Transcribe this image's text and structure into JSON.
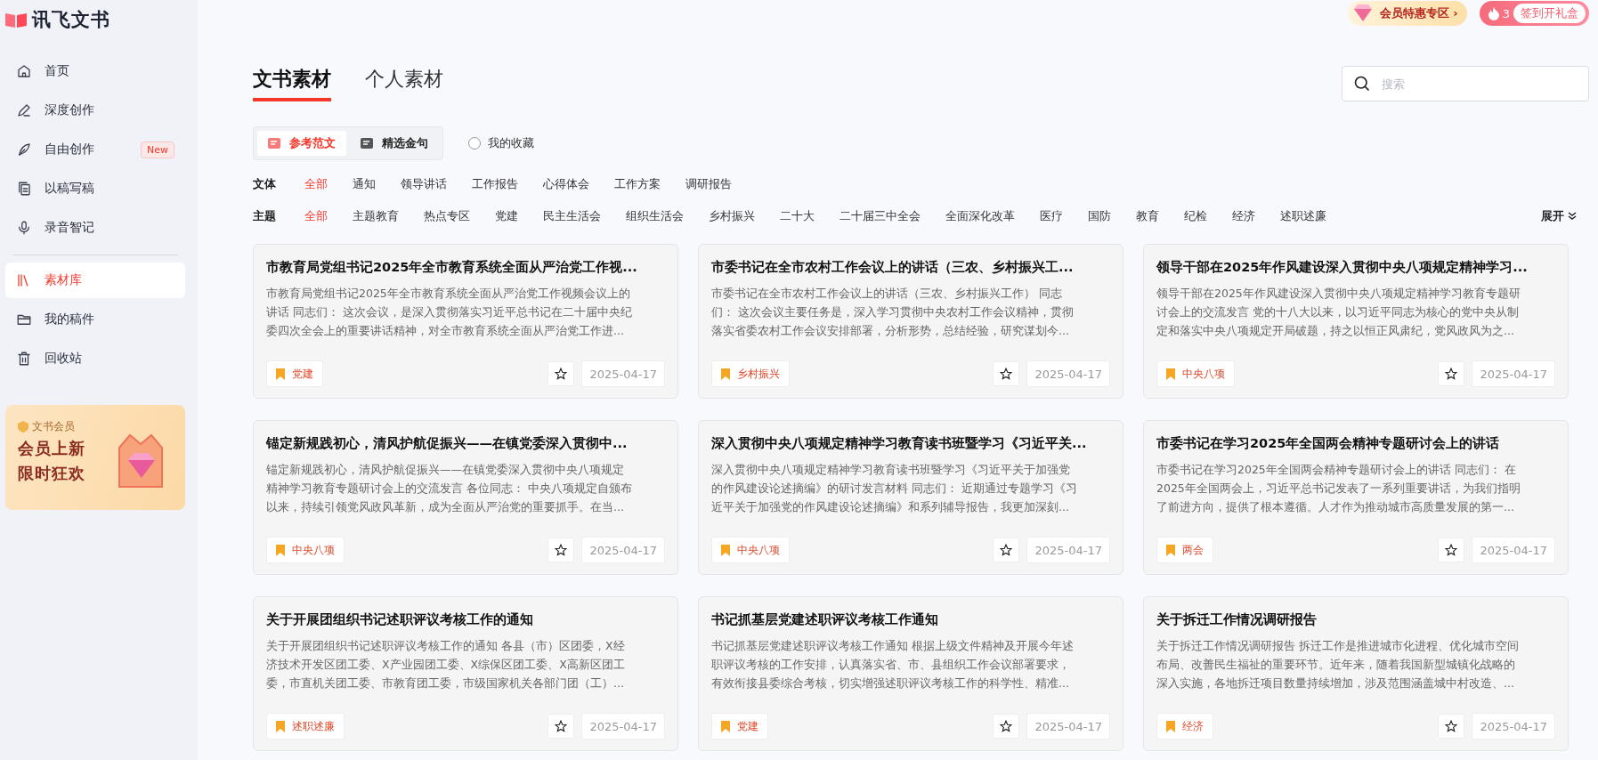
{
  "brand": {
    "name": "讯飞文书"
  },
  "nav_groups": [
    {
      "items": [
        {
          "label": "首页",
          "kind": "home",
          "selected": false
        },
        {
          "label": "深度创作",
          "kind": "pen",
          "selected": false
        },
        {
          "label": "自由创作",
          "kind": "feather",
          "selected": false,
          "badge": "New"
        },
        {
          "label": "以稿写稿",
          "kind": "copy",
          "selected": false
        },
        {
          "label": "录音智记",
          "kind": "mic",
          "selected": false
        }
      ]
    },
    {
      "items": [
        {
          "label": "素材库",
          "kind": "books",
          "selected": true
        },
        {
          "label": "我的稿件",
          "kind": "folder",
          "selected": false
        },
        {
          "label": "回收站",
          "kind": "trash",
          "selected": false
        }
      ]
    }
  ],
  "promo": {
    "tag": "文书会员",
    "lines": [
      "会员上新",
      "限时狂欢"
    ]
  },
  "topbar": {
    "vip": "会员特惠专区",
    "vip_arrow": "›",
    "streak": "3",
    "checkin": "签到开礼盒"
  },
  "tabs": [
    {
      "label": "文书素材",
      "selected": true
    },
    {
      "label": "个人素材",
      "selected": false
    }
  ],
  "search": {
    "placeholder": "搜索"
  },
  "segments": [
    {
      "label": "参考范文",
      "selected": true
    },
    {
      "label": "精选金句",
      "selected": false
    }
  ],
  "favorites": {
    "label": "我的收藏",
    "checked": false
  },
  "filters": [
    {
      "label": "文体",
      "options": [
        {
          "label": "全部",
          "selected": true
        },
        {
          "label": "通知",
          "selected": false
        },
        {
          "label": "领导讲话",
          "selected": false
        },
        {
          "label": "工作报告",
          "selected": false
        },
        {
          "label": "心得体会",
          "selected": false
        },
        {
          "label": "工作方案",
          "selected": false
        },
        {
          "label": "调研报告",
          "selected": false
        }
      ]
    },
    {
      "label": "主题",
      "expand": "展开",
      "options": [
        {
          "label": "全部",
          "selected": true
        },
        {
          "label": "主题教育",
          "selected": false
        },
        {
          "label": "热点专区",
          "selected": false
        },
        {
          "label": "党建",
          "selected": false
        },
        {
          "label": "民主生活会",
          "selected": false
        },
        {
          "label": "组织生活会",
          "selected": false
        },
        {
          "label": "乡村振兴",
          "selected": false
        },
        {
          "label": "二十大",
          "selected": false
        },
        {
          "label": "二十届三中全会",
          "selected": false
        },
        {
          "label": "全面深化改革",
          "selected": false
        },
        {
          "label": "医疗",
          "selected": false
        },
        {
          "label": "国防",
          "selected": false
        },
        {
          "label": "教育",
          "selected": false
        },
        {
          "label": "纪检",
          "selected": false
        },
        {
          "label": "经济",
          "selected": false
        },
        {
          "label": "述职述廉",
          "selected": false
        }
      ]
    }
  ],
  "cards": [
    {
      "title": "市教育局党组书记2025年全市教育系统全面从严治党工作视...",
      "lines": [
        "市教育局党组书记2025年全市教育系统全面从严治党工作视频会议上的",
        "讲话 同志们： 这次会议，是深入贯彻落实习近平总书记在二十届中央纪",
        "委四次全会上的重要讲话精神，对全市教育系统全面从严治党工作进..."
      ],
      "tag": "党建",
      "date": "2025-04-17"
    },
    {
      "title": "市委书记在全市农村工作会议上的讲话（三农、乡村振兴工...",
      "lines": [
        "市委书记在全市农村工作会议上的讲话（三农、乡村振兴工作） 同志",
        "们： 这次会议主要任务是，深入学习贯彻中央农村工作会议精神，贯彻",
        "落实省委农村工作会议安排部署，分析形势，总结经验，研究谋划今..."
      ],
      "tag": "乡村振兴",
      "date": "2025-04-17"
    },
    {
      "title": "领导干部在2025年作风建设深入贯彻中央八项规定精神学习...",
      "lines": [
        "领导干部在2025年作风建设深入贯彻中央八项规定精神学习教育专题研",
        "讨会上的交流发言 党的十八大以来，以习近平同志为核心的党中央从制",
        "定和落实中央八项规定开局破题，持之以恒正风肃纪，党风政风为之..."
      ],
      "tag": "中央八项",
      "date": "2025-04-17"
    },
    {
      "title": "锚定新规践初心，清风护航促振兴——在镇党委深入贯彻中...",
      "lines": [
        "锚定新规践初心，清风护航促振兴——在镇党委深入贯彻中央八项规定",
        "精神学习教育专题研讨会上的交流发言 各位同志： 中央八项规定自颁布",
        "以来，持续引领党风政风革新，成为全面从严治党的重要抓手。在当..."
      ],
      "tag": "中央八项",
      "date": "2025-04-17"
    },
    {
      "title": "深入贯彻中央八项规定精神学习教育读书班暨学习《习近平关...",
      "lines": [
        "深入贯彻中央八项规定精神学习教育读书班暨学习《习近平关于加强党",
        "的作风建设论述摘编》的研讨发言材料 同志们： 近期通过专题学习《习",
        "近平关于加强党的作风建设论述摘编》和系列辅导报告，我更加深刻..."
      ],
      "tag": "中央八项",
      "date": "2025-04-17"
    },
    {
      "title": "市委书记在学习2025年全国两会精神专题研讨会上的讲话",
      "lines": [
        "市委书记在学习2025年全国两会精神专题研讨会上的讲话 同志们： 在",
        "2025年全国两会上，习近平总书记发表了一系列重要讲话，为我们指明",
        "了前进方向，提供了根本遵循。人才作为推动城市高质量发展的第一..."
      ],
      "tag": "两会",
      "date": "2025-04-17"
    },
    {
      "title": "关于开展团组织书记述职评议考核工作的通知",
      "lines": [
        "关于开展团组织书记述职评议考核工作的通知 各县（市）区团委，X经",
        "济技术开发区团工委、X产业园团工委、X综保区团工委、X高新区团工",
        "委，市直机关团工委、市教育团工委，市级国家机关各部门团（工）..."
      ],
      "tag": "述职述廉",
      "date": "2025-04-17"
    },
    {
      "title": "书记抓基层党建述职评议考核工作通知",
      "lines": [
        "书记抓基层党建述职评议考核工作通知 根据上级文件精神及开展今年述",
        "职评议考核的工作安排，认真落实省、市、县组织工作会议部署要求，",
        "有效衔接县委综合考核，切实增强述职评议考核工作的科学性、精准..."
      ],
      "tag": "党建",
      "date": "2025-04-17"
    },
    {
      "title": "关于拆迁工作情况调研报告",
      "lines": [
        "关于拆迁工作情况调研报告 拆迁工作是推进城市化进程、优化城市空间",
        "布局、改善民生福祉的重要环节。近年来，随着我国新型城镇化战略的",
        "深入实施，各地拆迁项目数量持续增加，涉及范围涵盖城中村改造、..."
      ],
      "tag": "经济",
      "date": "2025-04-17"
    }
  ]
}
